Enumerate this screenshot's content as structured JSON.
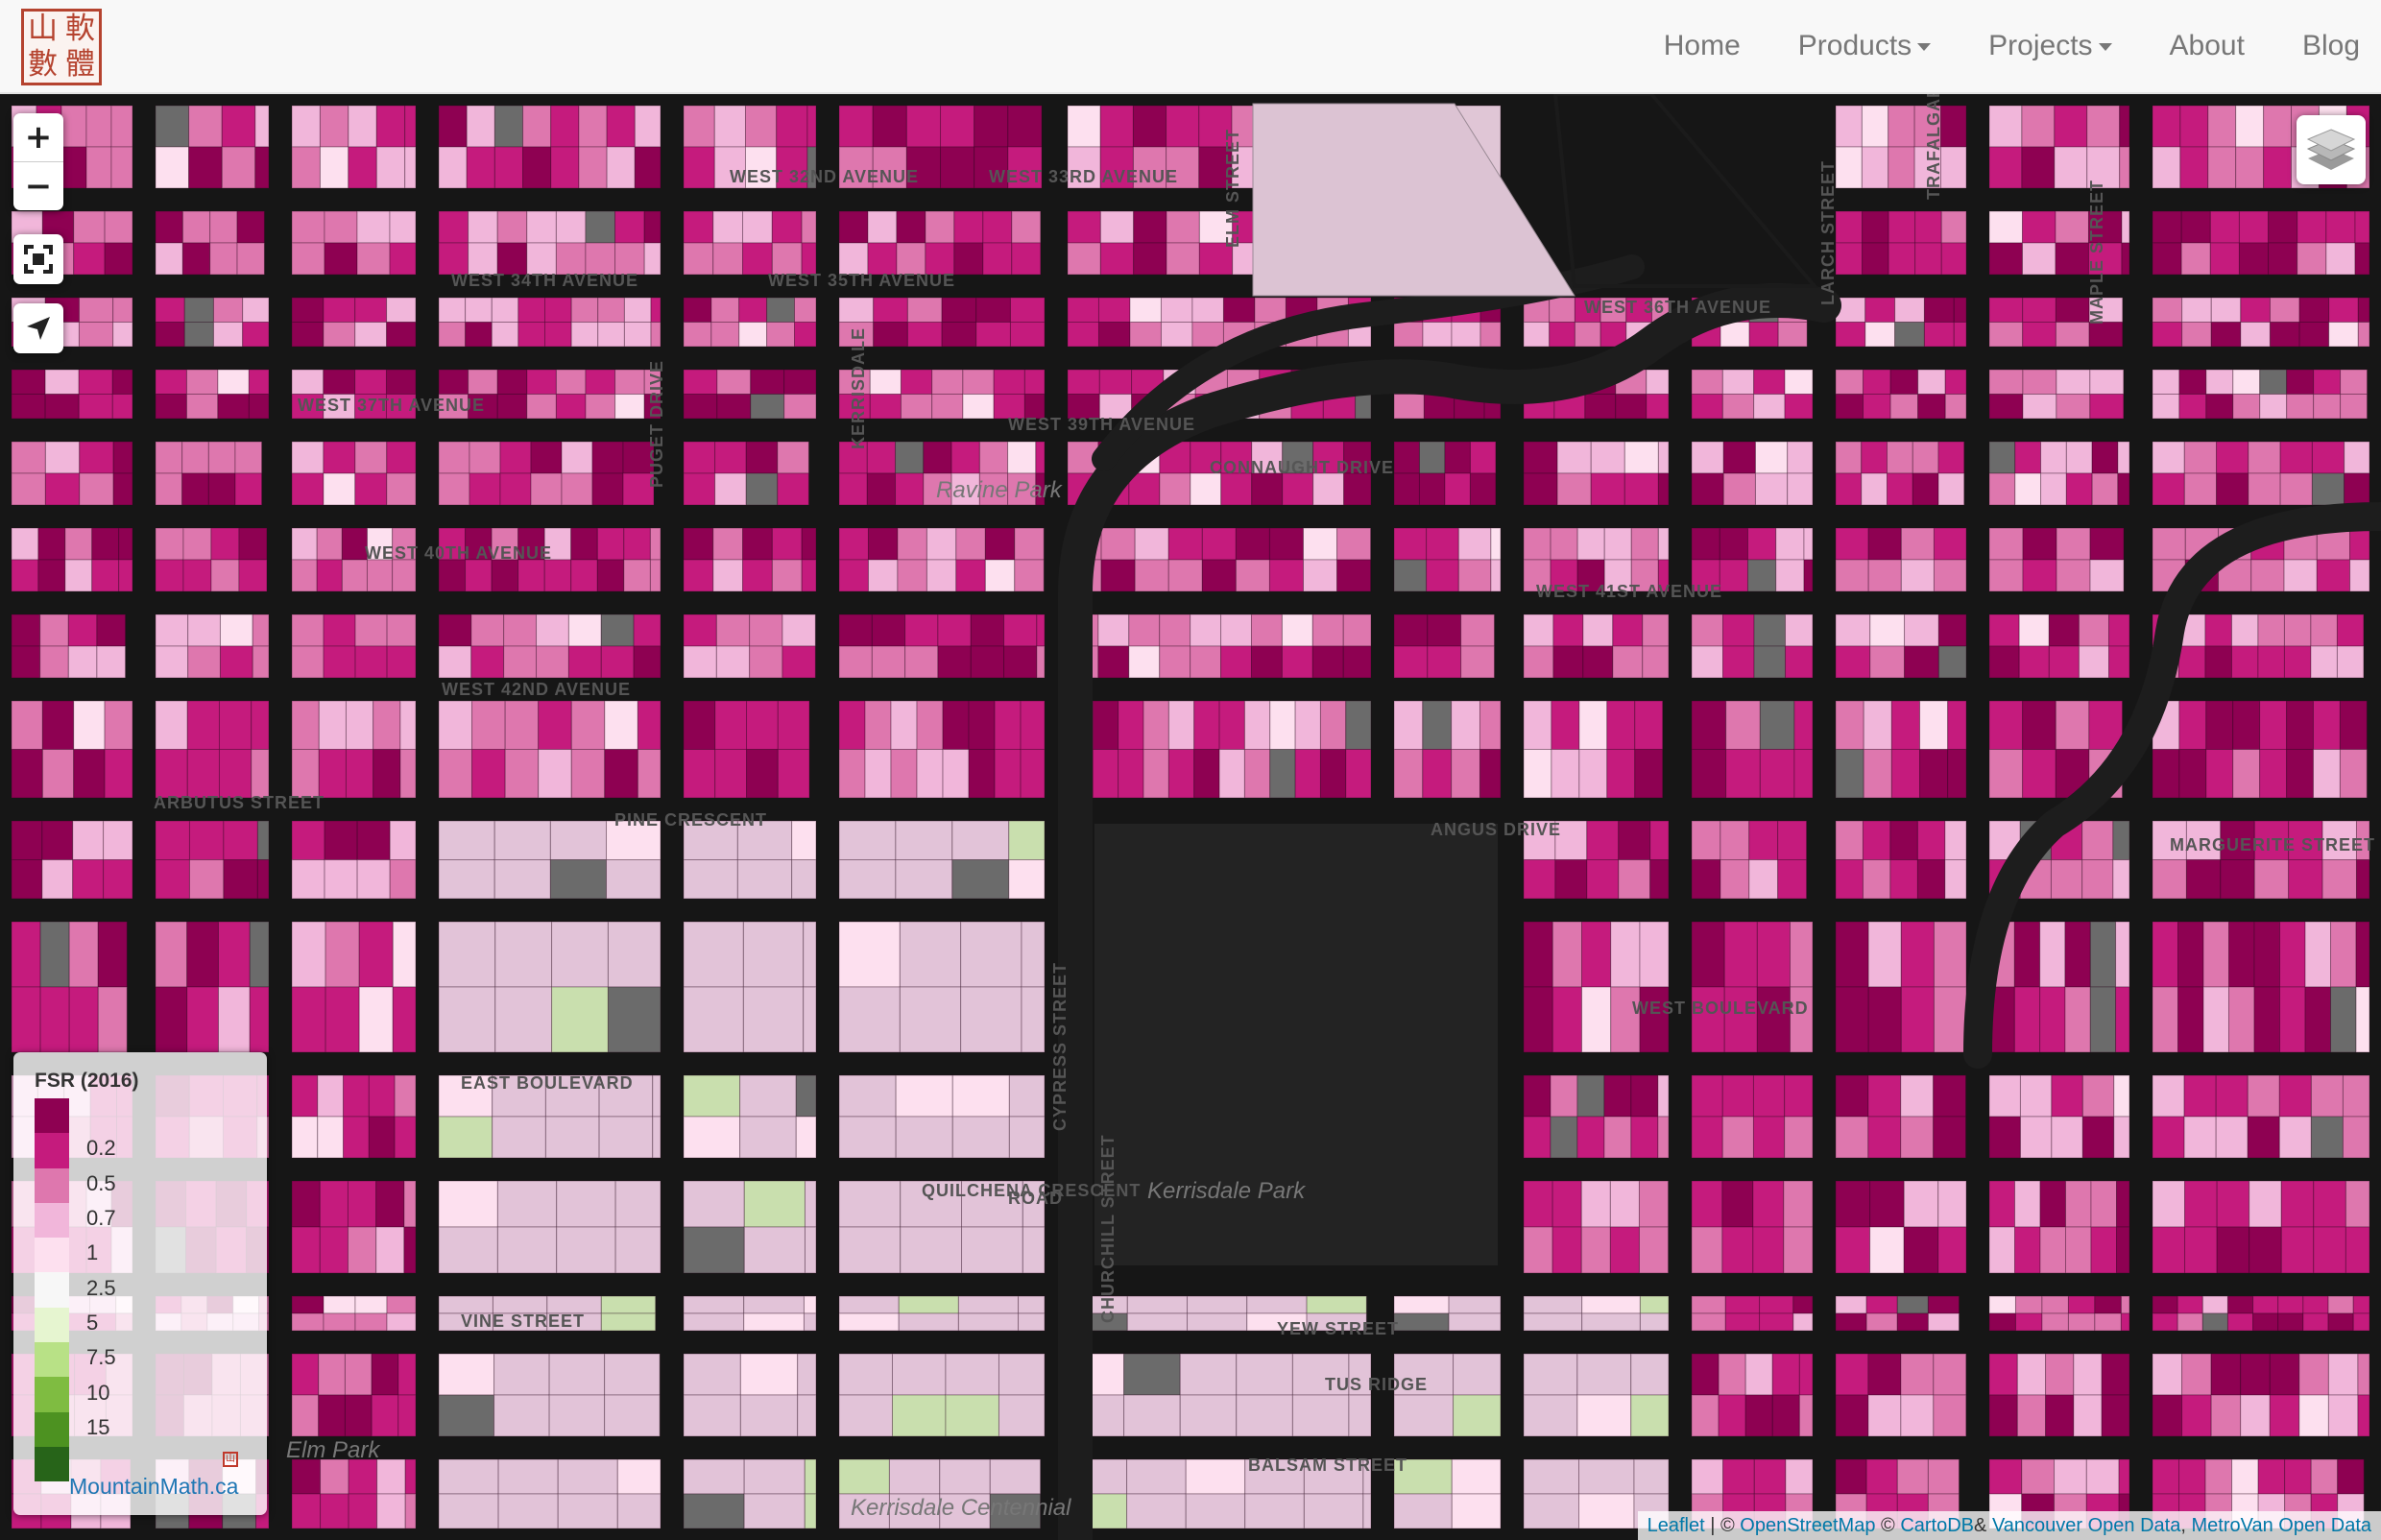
{
  "navbar": {
    "logo_chars": [
      "山",
      "軟",
      "數",
      "體"
    ],
    "links": [
      {
        "label": "Home",
        "dropdown": false
      },
      {
        "label": "Products",
        "dropdown": true
      },
      {
        "label": "Projects",
        "dropdown": true
      },
      {
        "label": "About",
        "dropdown": false
      },
      {
        "label": "Blog",
        "dropdown": false
      }
    ]
  },
  "map_controls": {
    "zoom_in": "+",
    "zoom_out": "−",
    "fullscreen_icon": "fullscreen-icon",
    "locate_icon": "locate-arrow-icon",
    "layers_icon": "layers-icon"
  },
  "legend": {
    "title": "FSR (2016)",
    "entries": [
      {
        "label": "",
        "color": "#8e0152"
      },
      {
        "label": "0.2",
        "color": "#c51b7d"
      },
      {
        "label": "0.5",
        "color": "#de77ae"
      },
      {
        "label": "0.7",
        "color": "#f1b6da"
      },
      {
        "label": "1",
        "color": "#fde0ef"
      },
      {
        "label": "2.5",
        "color": "#f7f7f7"
      },
      {
        "label": "5",
        "color": "#e6f5d0"
      },
      {
        "label": "7.5",
        "color": "#b8e186"
      },
      {
        "label": "10",
        "color": "#7fbc41"
      },
      {
        "label": "15",
        "color": "#4d9221"
      },
      {
        "label": "",
        "color": "#276419"
      }
    ],
    "brand": "MountainMath.ca"
  },
  "map_labels": {
    "streets": [
      "WEST 32ND AVENUE",
      "WEST 33RD AVENUE",
      "WEST 34TH AVENUE",
      "WEST 35TH AVENUE",
      "WEST 36TH AVENUE",
      "WEST 37TH AVENUE",
      "WEST 39TH AVENUE",
      "WEST 40TH AVENUE",
      "WEST 41ST AVENUE",
      "WEST 42ND AVENUE",
      "ARBUTUS STREET",
      "PINE CRESCENT",
      "ANGUS DRIVE",
      "MARGUERITE STREET",
      "WEST BOULEVARD",
      "EAST BOULEVARD",
      "QUILCHENA CRESCENT",
      "VINE STREET",
      "YEW STREET",
      "BALSAM STREET",
      "ELM STREET",
      "LARCH STREET",
      "TRAFALGAR STREET",
      "MAPLE STREET",
      "CYPRESS STREET",
      "CHURCHILL STREET",
      "CONNAUGHT DRIVE",
      "PUGET DRIVE",
      "KERRISDALE",
      "ROAD",
      "TUS RIDGE"
    ],
    "parks": [
      "Kerrisdale Park",
      "Ravine Park",
      "Elm Park",
      "Kerrisdale Centennial"
    ]
  },
  "attribution": {
    "leaflet": "Leaflet",
    "separator": " | © ",
    "osm": "OpenStreetMap",
    "copy2": " © ",
    "carto": "CartoDB",
    "amp": "& ",
    "van": "Vancouver Open Data",
    "comma": ", ",
    "metro": "MetroVan Open Data"
  }
}
